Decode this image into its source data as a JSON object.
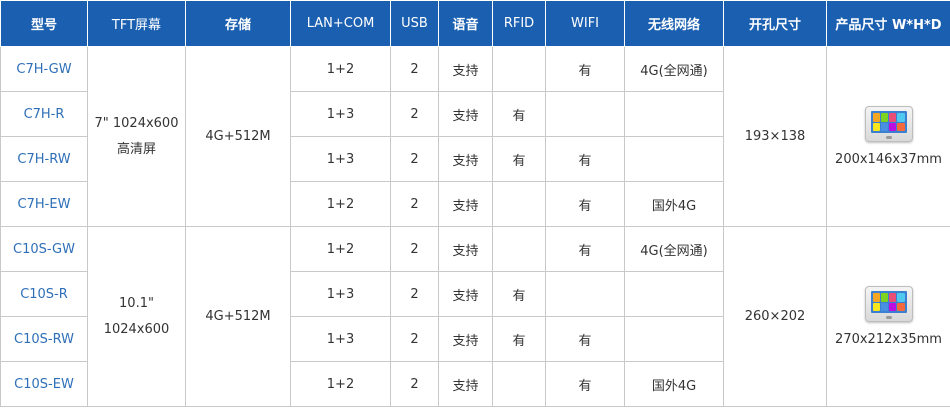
{
  "header": [
    "型号",
    "TFT屏幕",
    "存储",
    "LAN+COM",
    "USB",
    "语音",
    "RFID",
    "WIFI",
    "无线网络",
    "开孔尺寸",
    "产品尺寸 W*H*D"
  ],
  "groups": [
    {
      "screen": "7\" 1024x600",
      "screen_line2": "高清屏",
      "storage": "4G+512M",
      "cutout": "193×138",
      "product_size": "200x146x37mm",
      "image_icon": "touch-panel-device-icon",
      "rows": [
        {
          "model": "C7H-GW",
          "lan_com": "1+2",
          "usb": "2",
          "voice": "支持",
          "rfid": "",
          "wifi": "有",
          "wireless": "4G(全网通)"
        },
        {
          "model": "C7H-R",
          "lan_com": "1+3",
          "usb": "2",
          "voice": "支持",
          "rfid": "有",
          "wifi": "",
          "wireless": ""
        },
        {
          "model": "C7H-RW",
          "lan_com": "1+3",
          "usb": "2",
          "voice": "支持",
          "rfid": "有",
          "wifi": "有",
          "wireless": ""
        },
        {
          "model": "C7H-EW",
          "lan_com": "1+2",
          "usb": "2",
          "voice": "支持",
          "rfid": "",
          "wifi": "有",
          "wireless": "国外4G"
        }
      ]
    },
    {
      "screen": "10.1\"",
      "screen_line2": "1024x600",
      "storage": "4G+512M",
      "cutout": "260×202",
      "product_size": "270x212x35mm",
      "image_icon": "touch-panel-device-icon",
      "rows": [
        {
          "model": "C10S-GW",
          "lan_com": "1+2",
          "usb": "2",
          "voice": "支持",
          "rfid": "",
          "wifi": "有",
          "wireless": "4G(全网通)"
        },
        {
          "model": "C10S-R",
          "lan_com": "1+3",
          "usb": "2",
          "voice": "支持",
          "rfid": "有",
          "wifi": "",
          "wireless": ""
        },
        {
          "model": "C10S-RW",
          "lan_com": "1+3",
          "usb": "2",
          "voice": "支持",
          "rfid": "有",
          "wifi": "有",
          "wireless": ""
        },
        {
          "model": "C10S-EW",
          "lan_com": "1+2",
          "usb": "2",
          "voice": "支持",
          "rfid": "",
          "wifi": "有",
          "wireless": "国外4G"
        }
      ]
    }
  ],
  "colors": {
    "header_bg": "#1a5fb0",
    "model_text": "#2e6fb8",
    "border": "#c9c9c9"
  }
}
